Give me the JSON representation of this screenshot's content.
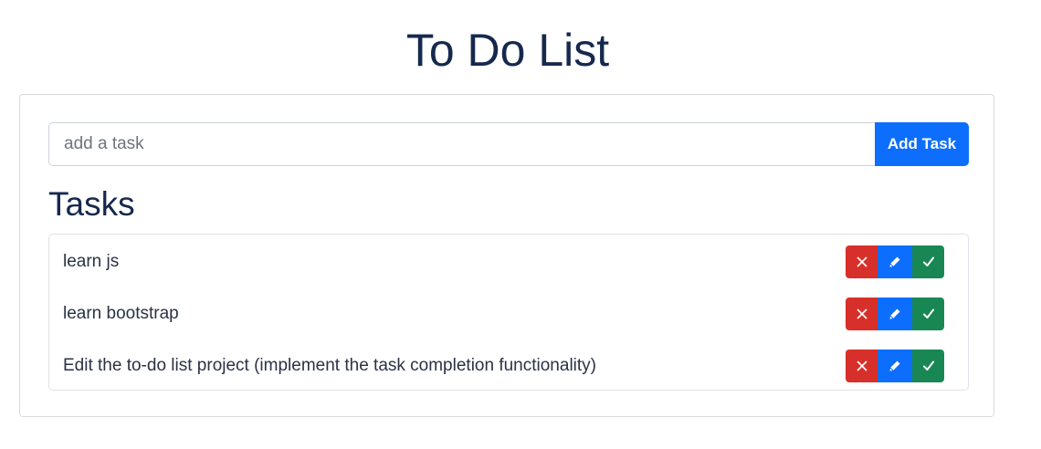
{
  "header": {
    "title": "To Do List"
  },
  "form": {
    "placeholder": "add a task",
    "value": "",
    "add_label": "Add Task"
  },
  "tasks_section": {
    "heading": "Tasks"
  },
  "tasks": [
    {
      "text": "learn js"
    },
    {
      "text": "learn bootstrap"
    },
    {
      "text": "Edit the to-do list project (implement the task completion functionality)"
    }
  ],
  "icons": {
    "delete": "close-icon",
    "edit": "pencil-icon",
    "complete": "check-icon"
  },
  "colors": {
    "primary": "#0d6efd",
    "danger": "#d7302a",
    "success": "#198754",
    "title": "#16294d"
  }
}
